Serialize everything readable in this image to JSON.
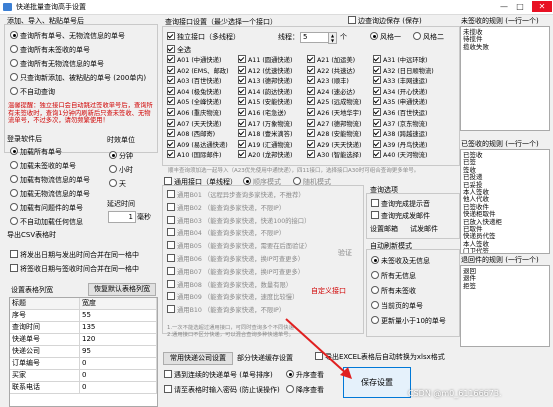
{
  "window": {
    "title": "快递批量查询高手设置",
    "minimize": "—",
    "maximize": "□",
    "close": "✕"
  },
  "left": {
    "add_section": "添加、导入、粘贴单号后",
    "add_options": [
      {
        "label": "查询所有单号、无物流信息的单号",
        "on": true
      },
      {
        "label": "查询所有未签收的单号",
        "on": false
      },
      {
        "label": "查询所有无物流信息的单号",
        "on": false
      },
      {
        "label": "只查询新添加、被粘贴的单号 (200单内)",
        "on": false
      },
      {
        "label": "不自动查询",
        "on": false
      }
    ],
    "warning": "温馨提醒：独立接口会自动跳过签收单号后，查询所有未签收时，查询1分钟内刷新后只查未签收、无物流单号，不过多次，请勿频繁使用！",
    "login_title": "登录软件后",
    "login_options": [
      {
        "label": "加载所有单号",
        "on": true
      },
      {
        "label": "加载未签收的单号",
        "on": false
      },
      {
        "label": "加载有物流信息的单号",
        "on": false
      },
      {
        "label": "加载无物流信息的单号",
        "on": false
      },
      {
        "label": "加载有问题件的单号",
        "on": false
      },
      {
        "label": "不自动加载任何信息",
        "on": false
      }
    ],
    "time_unit_title": "时效单位",
    "time_units": [
      {
        "label": "分钟",
        "on": true
      },
      {
        "label": "小时",
        "on": false
      },
      {
        "label": "天",
        "on": false
      }
    ],
    "delay_title": "延迟时间",
    "delay_value": "1",
    "delay_unit": "毫秒",
    "export_title": "导出CSV表格时",
    "export_options": [
      {
        "label": "将发出日期与发出时间合并在同一格中",
        "on": false
      },
      {
        "label": "将签收日期与签收时间合并在同一格中",
        "on": false
      }
    ],
    "columns_title": "设置表格列宽",
    "reset_button": "恢复默认表格列宽",
    "table_headers": [
      "标题",
      "宽度"
    ],
    "table_rows": [
      [
        "序号",
        "55"
      ],
      [
        "查询时间",
        "135"
      ],
      [
        "快递单号",
        "120"
      ],
      [
        "快递公司",
        "95"
      ],
      [
        "订单编号",
        "0"
      ],
      [
        "买家",
        "0"
      ],
      [
        "联系电话",
        "0"
      ]
    ]
  },
  "middle": {
    "title": "查询接口设置（最少选择一个接口）",
    "top_row": {
      "independent": "独立接口（多线程）",
      "threads_label": "线程：",
      "threads": "5",
      "unit": "个",
      "style1": "风格一",
      "style2": "风格二"
    },
    "select_all": "全选",
    "interfaces": [
      [
        "A01 (中通快递)",
        "A11 (圆通快递)",
        "A21 (加运美)",
        "A31 (中远环球)"
      ],
      [
        "A02 (EMS、邮政)",
        "A12 (优速快递)",
        "A22 (共速达)",
        "A32 (日日顺物流)"
      ],
      [
        "A03 (百世快递)",
        "A13 (德邦快递)",
        "A23 (顺丰)",
        "A33 (丰网速运)"
      ],
      [
        "A04 (极兔快递)",
        "A14 (韵达快递)",
        "A24 (速必达)",
        "A34 (开心快递)"
      ],
      [
        "A05 (全峰快递)",
        "A15 (安能快递)",
        "A25 (远成物流)",
        "A35 (申通快递)"
      ],
      [
        "A06 (重庆物流)",
        "A16 (宅急送)",
        "A26 (天地华宇)",
        "A36 (百世快运)"
      ],
      [
        "A07 (天天快递)",
        "A17 (万象物流)",
        "A27 (德邦物流)",
        "A37 (京东物流)"
      ],
      [
        "A08 (西邮寄)",
        "A18 (壹米滴答)",
        "A28 (安能物流)",
        "A38 (跨越速运)"
      ],
      [
        "A09 (易达通快递)",
        "A19 (汇通物流)",
        "A29 (天天快递)",
        "A39 (丹鸟快递)"
      ],
      [
        "A10 (国际邮件)",
        "A20 (龙邦快递)",
        "A30 (智能选择)",
        "A40 (天河物流)"
      ]
    ],
    "interfaces_checked": [
      true,
      true,
      true,
      true
    ],
    "interface_note": "顺丰查询须加选一起导入（A23优先使用中通快递），四11接口，选择接口A30时可组合查询更多单号。",
    "common_title": "通用接口（单线程）",
    "common_modes": [
      "顺序模式",
      "随机模式"
    ],
    "common_items": [
      "通用B01 （远程异步查询多家快递，不推荐）",
      "通用B02 （能查询多家快递，不限IP）",
      "通用B03 （能查询多家快递，快递100的接口）",
      "通用B04 （能查询多家快递，不限IP）",
      "通用B05 （能查询多家快递，需要在后面验证）",
      "通用B06 （能查询多家快递，换IP可查更多）",
      "通用B07 （能查询多家快递，换IP可查更多）",
      "通用B08 （能查询多家快递，数量有限）",
      "通用B09 （能查询多家快递，速度比较慢）",
      "通用B10 （能查询多家快递，不限IP）"
    ],
    "verify": "验证",
    "custom_interface": "自定义接口",
    "common_note1": "1.一次不能选超过通用接口，可同时查询多个不同快递",
    "common_note2": "2.通用接口不区分快递，可以混合查询多种快递单号。",
    "common_settings_btn": "常用快递公司设置",
    "partial_btn": "部分快递缓存设置",
    "query_section": "查询选项",
    "query_opts": [
      {
        "label": "查询完成提示音",
        "on": false
      },
      {
        "label": "查询完成发邮件",
        "on": false
      }
    ],
    "email_settings": "设置邮箱",
    "test_email": "试发邮件",
    "refresh_section": "自动刷新模式",
    "refresh_opts": [
      {
        "label": "未签收及无信息",
        "on": true
      },
      {
        "label": "所有无信息",
        "on": false
      },
      {
        "label": "所有未签收",
        "on": false
      },
      {
        "label": "当前页的单号",
        "on": false
      },
      {
        "label": "更新量小于10的单号",
        "on": false
      }
    ],
    "export_excel": "导出EXCEL表格后自动转换为xlsx格式",
    "bottom_opt1": "遇到连续的快递单号 (单号排序)",
    "bottom_opt2": "请至表格时输入密码 (防止误操作)",
    "asc": "升序查看",
    "desc": "降序查看",
    "save_button": "保存设置",
    "watermark": "CSDN @m0_61166673."
  },
  "right": {
    "skip_checkbox": "过滤词设置 (去掉)",
    "skip_option": "边查询边保存 (保存)",
    "unsigned_title": "未签收的规则 (一行一个)",
    "unsigned_rules": [
      "未揽收",
      "待揽件",
      "揽收失败"
    ],
    "signed_title": "已签收的规则 (一行一个)",
    "signed_rules": [
      "已签收",
      "已签",
      "签收",
      "已投递",
      "已妥投",
      "本人签收",
      "他人代收",
      "已签收件",
      "快递柜取件",
      "已放入快递柜",
      "已取件",
      "快递员代签",
      "本人签收",
      "门卫代签"
    ],
    "return_title": "退回件的规则 (一行一个)",
    "return_rules": [
      "退回",
      "退件",
      "拒签"
    ]
  }
}
